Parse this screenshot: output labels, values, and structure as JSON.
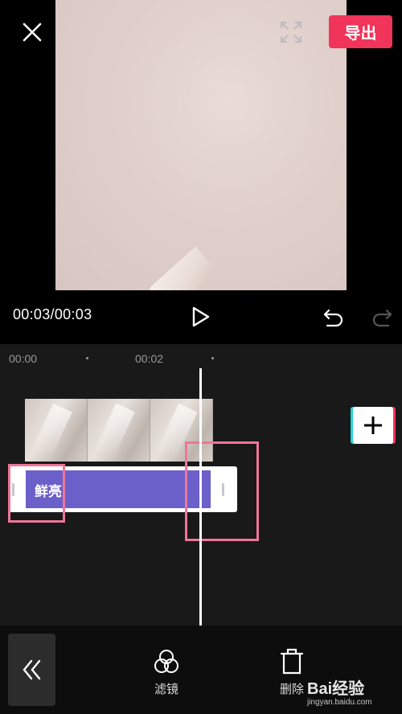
{
  "header": {
    "export_label": "导出"
  },
  "player": {
    "time": "00:03/00:03"
  },
  "timeline": {
    "ruler": [
      "00:00",
      "00:02"
    ],
    "filter_clip": {
      "label": "鲜亮"
    }
  },
  "toolbar": {
    "tools": [
      {
        "label": "滤镜",
        "icon": "filter-icon"
      },
      {
        "label": "删除",
        "icon": "delete-icon"
      }
    ]
  },
  "watermark": {
    "brand": "Bai经验",
    "url": "jingyan.baidu.com"
  },
  "colors": {
    "accent": "#f0345a",
    "filter_fill": "#6b5fc9",
    "highlight": "#ef7597",
    "teal": "#23d3d8"
  }
}
